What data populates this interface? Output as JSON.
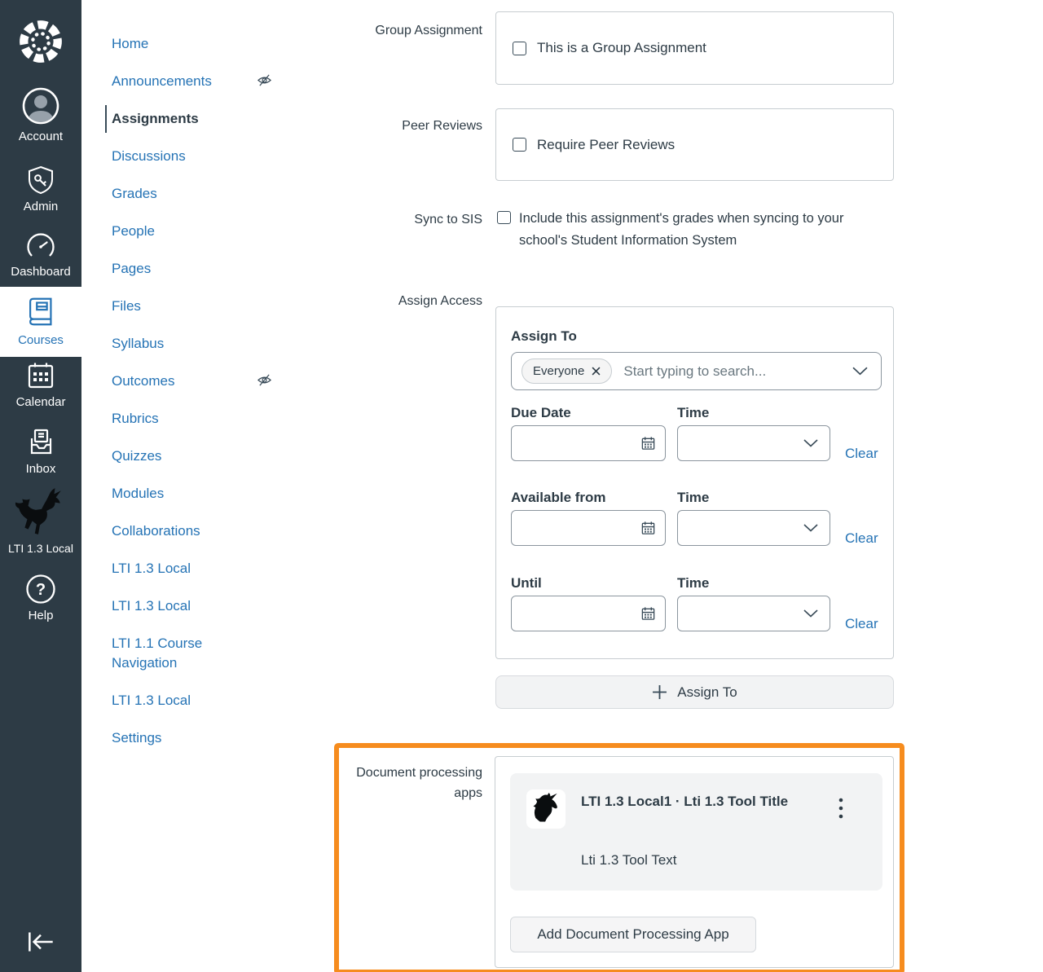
{
  "colors": {
    "sidebar_bg": "#2D3B45",
    "link_blue": "#2573B5",
    "text_dark": "#2D3B45",
    "highlight_orange": "#F68C1E",
    "card_gray": "#F2F3F4"
  },
  "global_nav": {
    "items": [
      {
        "label": "Account",
        "icon": "avatar-icon",
        "active": false
      },
      {
        "label": "Admin",
        "icon": "shield-key-icon",
        "active": false
      },
      {
        "label": "Dashboard",
        "icon": "gauge-icon",
        "active": false
      },
      {
        "label": "Courses",
        "icon": "book-icon",
        "active": true
      },
      {
        "label": "Calendar",
        "icon": "calendar-icon",
        "active": false
      },
      {
        "label": "Inbox",
        "icon": "inbox-tray-icon",
        "active": false
      },
      {
        "label": "LTI 1.3 Local",
        "icon": "unicorn-icon",
        "active": false
      },
      {
        "label": "Help",
        "icon": "question-circle-icon",
        "active": false
      }
    ]
  },
  "course_nav": {
    "items": [
      {
        "label": "Home",
        "hidden_indicator": false
      },
      {
        "label": "Announcements",
        "hidden_indicator": true
      },
      {
        "label": "Assignments",
        "hidden_indicator": false,
        "active": true
      },
      {
        "label": "Discussions",
        "hidden_indicator": false
      },
      {
        "label": "Grades",
        "hidden_indicator": false
      },
      {
        "label": "People",
        "hidden_indicator": false
      },
      {
        "label": "Pages",
        "hidden_indicator": false
      },
      {
        "label": "Files",
        "hidden_indicator": false
      },
      {
        "label": "Syllabus",
        "hidden_indicator": false
      },
      {
        "label": "Outcomes",
        "hidden_indicator": true
      },
      {
        "label": "Rubrics",
        "hidden_indicator": false
      },
      {
        "label": "Quizzes",
        "hidden_indicator": false
      },
      {
        "label": "Modules",
        "hidden_indicator": false
      },
      {
        "label": "Collaborations",
        "hidden_indicator": false
      },
      {
        "label": "LTI 1.3 Local",
        "hidden_indicator": false
      },
      {
        "label": "LTI 1.3 Local",
        "hidden_indicator": false
      },
      {
        "label": "LTI 1.1 Course Navigation",
        "hidden_indicator": false
      },
      {
        "label": "LTI 1.3 Local",
        "hidden_indicator": false
      },
      {
        "label": "Settings",
        "hidden_indicator": false
      }
    ]
  },
  "form": {
    "group_assignment": {
      "row_label": "Group Assignment",
      "checkbox_label": "This is a Group Assignment",
      "checked": false
    },
    "peer_reviews": {
      "row_label": "Peer Reviews",
      "checkbox_label": "Require Peer Reviews",
      "checked": false
    },
    "sync_to_sis": {
      "row_label": "Sync to SIS",
      "checkbox_label": "Include this assignment's grades when syncing to your school's Student Information System",
      "checked": false
    },
    "assign_access": {
      "row_label": "Assign Access",
      "heading": "Assign To",
      "selected_tag": "Everyone",
      "search_placeholder": "Start typing to search...",
      "rows": [
        {
          "date_label": "Due Date",
          "time_label": "Time",
          "date_value": "",
          "time_value": "",
          "clear_label": "Clear"
        },
        {
          "date_label": "Available from",
          "time_label": "Time",
          "date_value": "",
          "time_value": "",
          "clear_label": "Clear"
        },
        {
          "date_label": "Until",
          "time_label": "Time",
          "date_value": "",
          "time_value": "",
          "clear_label": "Clear"
        }
      ],
      "add_button_label": "Assign To"
    },
    "document_processing": {
      "row_label": "Document processing apps",
      "app": {
        "title": "LTI 1.3 Local1 · Lti 1.3 Tool Title",
        "description": "Lti 1.3 Tool Text"
      },
      "add_button_label": "Add Document Processing App"
    }
  },
  "icons": {
    "logo": "canvas-logo",
    "hidden_item": "eye-off-icon",
    "date_picker": "calendar-small-icon",
    "dropdown": "chevron-down-icon",
    "add": "plus-icon",
    "app_options": "kebab-menu-icon",
    "remove_tag": "x-icon",
    "collapse_nav": "collapse-arrow-icon"
  }
}
